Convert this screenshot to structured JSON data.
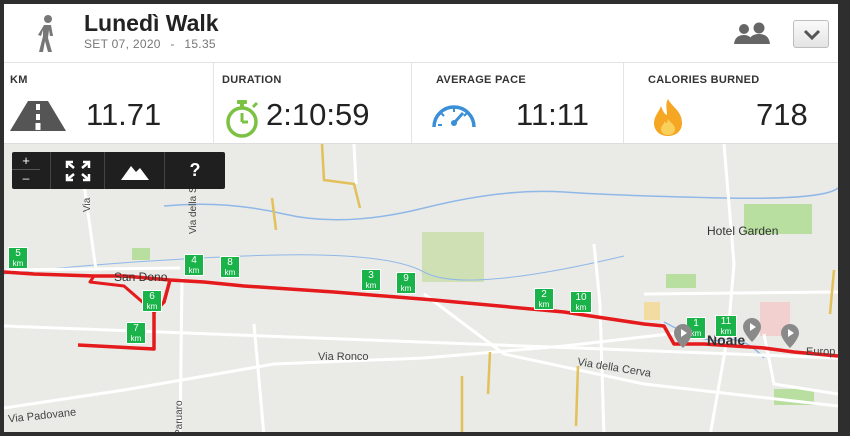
{
  "activity": {
    "title": "Lunedì Walk",
    "date": "SET 07, 2020",
    "separator": "-",
    "time": "15.35"
  },
  "stats": [
    {
      "label": "KM",
      "value": "11.71",
      "icon": "road-icon",
      "color": "#555555"
    },
    {
      "label": "DURATION",
      "value": "2:10:59",
      "icon": "stopwatch-icon",
      "color": "#7cc242"
    },
    {
      "label": "AVERAGE PACE",
      "value": "11:11",
      "icon": "speedometer-icon",
      "color": "#3a8fd6"
    },
    {
      "label": "CALORIES BURNED",
      "value": "718",
      "icon": "flame-icon",
      "color": "#f5a623"
    }
  ],
  "map_controls": {
    "zoom_in": "+",
    "zoom_out": "–",
    "help": "?"
  },
  "map": {
    "route_color": "#e41a1c",
    "marker_color": "#19b34a",
    "km_markers": [
      "1",
      "2",
      "3",
      "4",
      "5",
      "6",
      "7",
      "8",
      "9",
      "10",
      "11"
    ],
    "km_unit": "km",
    "labels": {
      "hotel": "Hotel Garden",
      "san_dono": "San Dono",
      "noale": "Noale",
      "via_ronco": "Via Ronco",
      "via_cerva": "Via della Cerva",
      "via_padovane": "Via Padovane",
      "via_scolara": "Via della Scolara",
      "paruaro": "Paruaro",
      "via": "Via",
      "europa": "Europ"
    }
  }
}
